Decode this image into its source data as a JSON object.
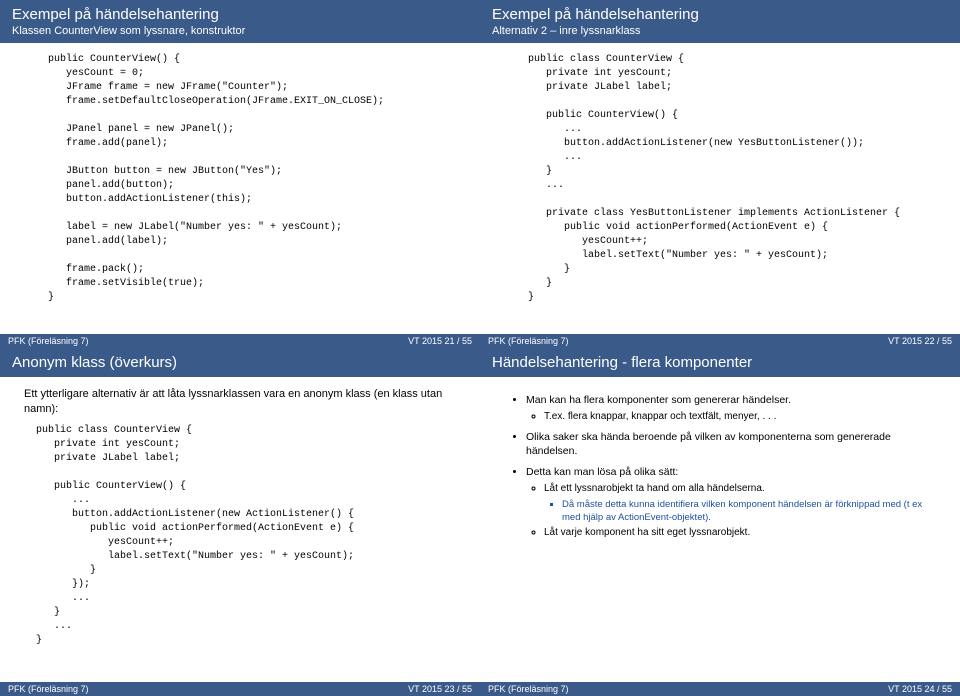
{
  "slides": [
    {
      "title": "Exempel på händelsehantering",
      "subtitle": "Klassen CounterView som lyssnare, konstruktor",
      "code": "    public CounterView() {\n       yesCount = 0;\n       JFrame frame = new JFrame(\"Counter\");\n       frame.setDefaultCloseOperation(JFrame.EXIT_ON_CLOSE);\n\n       JPanel panel = new JPanel();\n       frame.add(panel);\n\n       JButton button = new JButton(\"Yes\");\n       panel.add(button);\n       button.addActionListener(this);\n\n       label = new JLabel(\"Number yes: \" + yesCount);\n       panel.add(label);\n\n       frame.pack();\n       frame.setVisible(true);\n    }",
      "footer_left": "PFK (Föreläsning 7)",
      "footer_right": "VT 2015    21 / 55"
    },
    {
      "title": "Exempel på händelsehantering",
      "subtitle": "Alternativ 2 – inre lyssnarklass",
      "code": "    public class CounterView {\n       private int yesCount;\n       private JLabel label;\n\n       public CounterView() {\n          ...\n          button.addActionListener(new YesButtonListener());\n          ...\n       }\n       ...\n\n       private class YesButtonListener implements ActionListener {\n          public void actionPerformed(ActionEvent e) {\n             yesCount++;\n             label.setText(\"Number yes: \" + yesCount);\n          }\n       }\n    }",
      "footer_left": "PFK (Föreläsning 7)",
      "footer_right": "VT 2015    22 / 55"
    },
    {
      "title": "Anonym klass (överkurs)",
      "subtitle": "",
      "intro": "Ett ytterligare alternativ är att låta lyssnarklassen vara en anonym klass (en klass utan namn):",
      "code": "  public class CounterView {\n     private int yesCount;\n     private JLabel label;\n\n     public CounterView() {\n        ...\n        button.addActionListener(new ActionListener() {\n           public void actionPerformed(ActionEvent e) {\n              yesCount++;\n              label.setText(\"Number yes: \" + yesCount);\n           }\n        });\n        ...\n     }\n     ...\n  }",
      "footer_left": "PFK (Föreläsning 7)",
      "footer_right": "VT 2015    23 / 55"
    },
    {
      "title": "Händelsehantering - flera komponenter",
      "subtitle": "",
      "bullets": [
        {
          "text": "Man kan ha flera komponenter som genererar händelser.",
          "subs": [
            {
              "text": "T.ex. flera knappar, knappar och textfält, menyer, . . ."
            }
          ]
        },
        {
          "text": "Olika saker ska hända beroende på vilken av komponenterna som genererade händelsen."
        },
        {
          "text": "Detta kan man lösa på olika sätt:",
          "subs": [
            {
              "text": "Låt ett lyssnarobjekt ta hand om alla händelserna.",
              "subsubs": [
                "Då måste detta kunna identifiera vilken komponent händelsen är förknippad med (t ex med hjälp av ActionEvent-objektet)."
              ]
            },
            {
              "text": "Låt varje komponent ha sitt eget lyssnarobjekt."
            }
          ]
        }
      ],
      "footer_left": "PFK (Föreläsning 7)",
      "footer_right": "VT 2015    24 / 55"
    }
  ]
}
